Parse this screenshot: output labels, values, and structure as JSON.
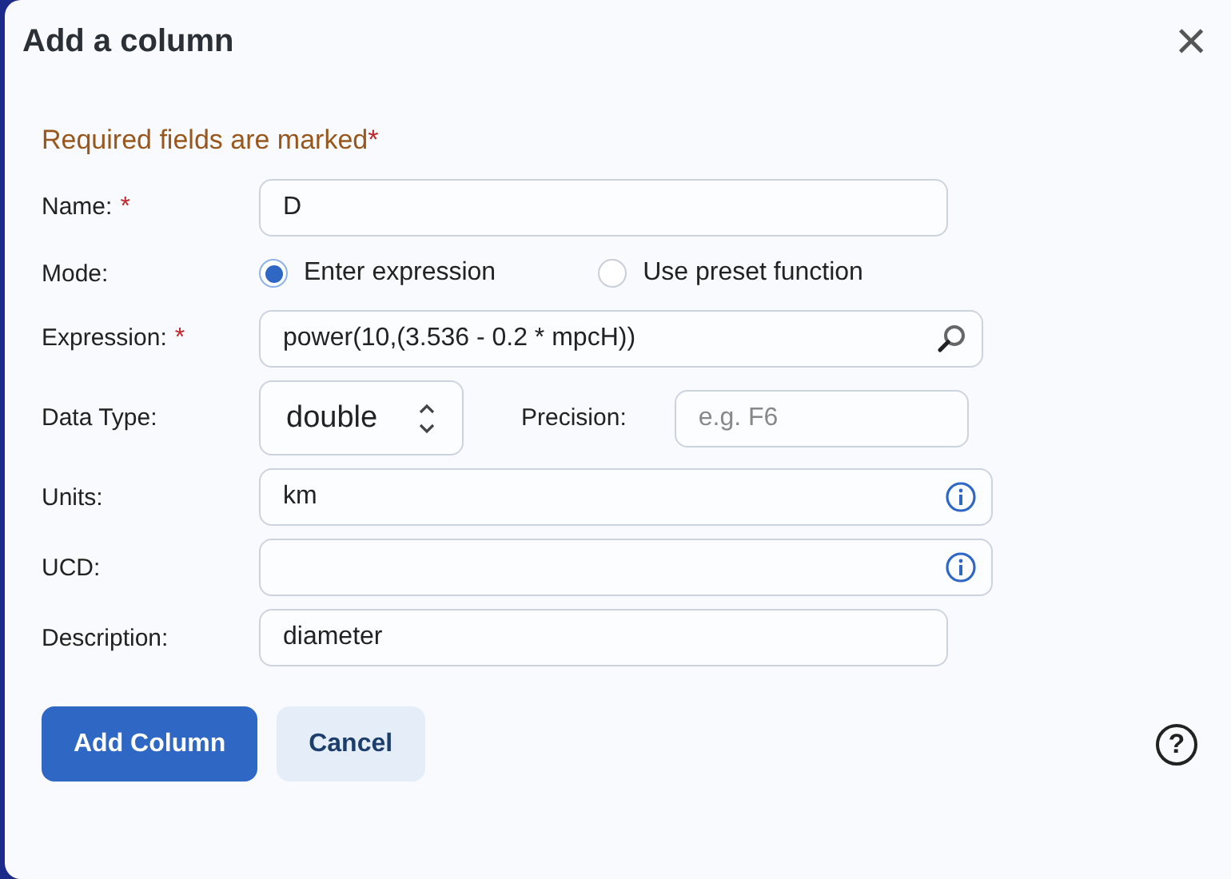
{
  "dialog": {
    "title": "Add a column",
    "close": "×"
  },
  "notice": {
    "text": "Required fields are marked",
    "mark": "*"
  },
  "fields": [
    {
      "kind": "text",
      "label": "Name:",
      "required": true,
      "value": "D"
    },
    {
      "kind": "radio",
      "label": "Mode:",
      "required": false,
      "options": [
        {
          "label": "Enter expression",
          "selected": true
        },
        {
          "label": "Use preset function",
          "selected": false
        }
      ]
    },
    {
      "kind": "search",
      "label": "Expression:",
      "required": true,
      "value": "power(10,(3.536 - 0.2 * mpcH))"
    },
    {
      "kind": "select",
      "label": "Data Type:",
      "required": false,
      "value": "double",
      "extra": {
        "label": "Precision:",
        "placeholder": "e.g. F6"
      }
    },
    {
      "kind": "info",
      "label": "Units:",
      "required": false,
      "value": "km"
    },
    {
      "kind": "info",
      "label": "UCD:",
      "required": false
    },
    {
      "kind": "text",
      "label": "Description:",
      "required": false,
      "value": "diameter"
    }
  ],
  "buttons": [
    {
      "label": "Add Column",
      "kind": "primary"
    },
    {
      "label": "Cancel",
      "kind": "secondary"
    }
  ],
  "help": "?"
}
